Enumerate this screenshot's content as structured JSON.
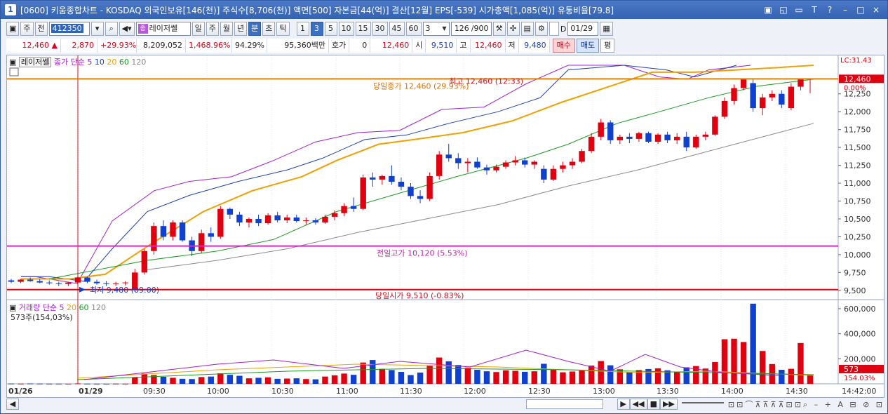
{
  "title": {
    "app_icon": "1",
    "text": "[0600] 키움종합차트 - KOSDAQ 외국인보유[146(천)] 주식수[8,706(천)] 액면[500] 자본금[44(억)] 결산[12월] EPS[-539] 시가총액[1,085(억)] 유통비율[79.8]"
  },
  "window_buttons": [
    "▣",
    "◱",
    "▭",
    "T",
    "?",
    "–",
    "□",
    "×"
  ],
  "toolbar": {
    "jm": "주",
    "jeon": "전",
    "code": "412350",
    "name": "레이저쎌",
    "periods": [
      "일",
      "주",
      "월",
      "년",
      "분",
      "초",
      "틱"
    ],
    "active_period": "분",
    "intervals": [
      "1",
      "3",
      "5",
      "10",
      "15",
      "30",
      "45",
      "60"
    ],
    "active_interval": "3",
    "interval_value": "3",
    "count": "126",
    "count_total": "/900",
    "date": "01/29",
    "date_prefix": "D"
  },
  "quote": {
    "price": "12,460",
    "change": "2,870",
    "change_pct": "+29.93%",
    "volume": "8,209,052",
    "volume_pct": "1,468.96%",
    "ratio": "94.29%",
    "amount": "95,360백만",
    "hoga_label": "호가",
    "hoga_value": "0",
    "hoga_price": "12,460",
    "open_label": "시",
    "open": "9,510",
    "high_label": "고",
    "high": "12,460",
    "low_label": "저",
    "low": "9,480",
    "buy_label": "매수",
    "sell_label": "매도",
    "avg_label": "평"
  },
  "price_legend": {
    "name": "레이저쎌",
    "ma_label": "종가 단순",
    "ma_periods": [
      "5",
      "10",
      "20",
      "60",
      "120"
    ],
    "ma_colors": [
      "#a020d0",
      "#1f3fb5",
      "#f0a000",
      "#1a9a20",
      "#888888"
    ]
  },
  "volume_legend": {
    "label": "거래량 단순",
    "periods": [
      "5",
      "20",
      "60",
      "120"
    ],
    "info": "573주(154,03%)"
  },
  "annotations": {
    "today_close": "당일종가 12,460 (29.93%)",
    "high": "최고 12,460 (12:33)",
    "prev_high": "전일고가 10,120 (5.53%)",
    "low": "최저 9,480 (09:00)",
    "today_open": "당일시가 9,510 (-0.83%)",
    "lc": "LC:31.43",
    "price_box": "12,460",
    "pct_box": "0.00%",
    "vol_box": "573",
    "vol_pct_box": "154.03%"
  },
  "chart_data": {
    "type": "candlestick",
    "price_axis": {
      "min": 9400,
      "max": 12650,
      "ticks": [
        "12,250",
        "12,000",
        "11,750",
        "11,500",
        "11,250",
        "11,000",
        "10,750",
        "10,500",
        "10,250",
        "10,000",
        "9,750",
        "9,500"
      ]
    },
    "volume_axis": {
      "min": 0,
      "max": 650000,
      "ticks": [
        "600,000",
        "400,000",
        "200,000"
      ]
    },
    "time_labels": [
      "01/26",
      "01/29",
      "09:30",
      "10:00",
      "10:30",
      "11:00",
      "11:30",
      "12:00",
      "12:30",
      "13:00",
      "13:30",
      "14:00",
      "14:30",
      "14:42:00"
    ],
    "levels": {
      "today_close": 12460,
      "prev_high": 10120,
      "today_open": 9510
    },
    "candles": [
      [
        9640,
        9660,
        9600,
        9620
      ],
      [
        9620,
        9660,
        9600,
        9650
      ],
      [
        9650,
        9680,
        9620,
        9630
      ],
      [
        9630,
        9660,
        9600,
        9610
      ],
      [
        9610,
        9640,
        9580,
        9600
      ],
      [
        9600,
        9620,
        9560,
        9590
      ],
      [
        9590,
        9620,
        9560,
        9610
      ],
      [
        9610,
        9700,
        9590,
        9680
      ],
      [
        9680,
        9690,
        9600,
        9620
      ],
      [
        9620,
        9650,
        9580,
        9600
      ],
      [
        9600,
        9630,
        9560,
        9590
      ],
      [
        9590,
        9620,
        9560,
        9600
      ],
      [
        9600,
        9630,
        9570,
        9610
      ],
      [
        9510,
        9800,
        9480,
        9750
      ],
      [
        9750,
        10080,
        9720,
        10050
      ],
      [
        10050,
        10450,
        10000,
        10400
      ],
      [
        10400,
        10480,
        10200,
        10250
      ],
      [
        10250,
        10480,
        10200,
        10450
      ],
      [
        10450,
        10480,
        10180,
        10200
      ],
      [
        10200,
        10250,
        9980,
        10050
      ],
      [
        10050,
        10350,
        10020,
        10300
      ],
      [
        10300,
        10380,
        10180,
        10250
      ],
      [
        10250,
        10680,
        10220,
        10640
      ],
      [
        10640,
        10660,
        10500,
        10560
      ],
      [
        10560,
        10600,
        10400,
        10450
      ],
      [
        10450,
        10520,
        10380,
        10500
      ],
      [
        10500,
        10560,
        10400,
        10440
      ],
      [
        10440,
        10580,
        10420,
        10550
      ],
      [
        10550,
        10600,
        10450,
        10480
      ],
      [
        10480,
        10560,
        10440,
        10520
      ],
      [
        10520,
        10560,
        10450,
        10470
      ],
      [
        10470,
        10520,
        10420,
        10480
      ],
      [
        10480,
        10510,
        10420,
        10450
      ],
      [
        10450,
        10560,
        10430,
        10530
      ],
      [
        10530,
        10620,
        10480,
        10580
      ],
      [
        10580,
        10720,
        10540,
        10680
      ],
      [
        10680,
        10800,
        10600,
        10640
      ],
      [
        10640,
        11120,
        10620,
        11080
      ],
      [
        11080,
        11150,
        10950,
        11050
      ],
      [
        11050,
        11120,
        10980,
        11100
      ],
      [
        11100,
        11250,
        10980,
        11020
      ],
      [
        11020,
        11080,
        10900,
        10950
      ],
      [
        10950,
        11000,
        10780,
        10820
      ],
      [
        10820,
        10900,
        10720,
        10780
      ],
      [
        10780,
        11150,
        10750,
        11100
      ],
      [
        11100,
        11450,
        11050,
        11400
      ],
      [
        11400,
        11550,
        11300,
        11350
      ],
      [
        11350,
        11420,
        11200,
        11280
      ],
      [
        11280,
        11350,
        11150,
        11300
      ],
      [
        11300,
        11360,
        11200,
        11220
      ],
      [
        11220,
        11260,
        11120,
        11180
      ],
      [
        11180,
        11260,
        11150,
        11230
      ],
      [
        11230,
        11320,
        11200,
        11290
      ],
      [
        11290,
        11380,
        11250,
        11320
      ],
      [
        11320,
        11360,
        11220,
        11260
      ],
      [
        11260,
        11320,
        11200,
        11300
      ],
      [
        11200,
        11250,
        11000,
        11050
      ],
      [
        11050,
        11250,
        11030,
        11200
      ],
      [
        11200,
        11300,
        11150,
        11250
      ],
      [
        11250,
        11350,
        11200,
        11300
      ],
      [
        11300,
        11480,
        11280,
        11450
      ],
      [
        11450,
        11700,
        11420,
        11650
      ],
      [
        11650,
        11900,
        11600,
        11850
      ],
      [
        11850,
        11880,
        11550,
        11600
      ],
      [
        11600,
        11680,
        11550,
        11650
      ],
      [
        11650,
        11700,
        11560,
        11620
      ],
      [
        11620,
        11720,
        11580,
        11700
      ],
      [
        11700,
        11720,
        11560,
        11580
      ],
      [
        11580,
        11700,
        11550,
        11680
      ],
      [
        11680,
        11720,
        11560,
        11600
      ],
      [
        11600,
        11700,
        11550,
        11650
      ],
      [
        11650,
        11720,
        11450,
        11500
      ],
      [
        11500,
        11680,
        11480,
        11650
      ],
      [
        11650,
        11720,
        11600,
        11680
      ],
      [
        11680,
        11950,
        11660,
        11930
      ],
      [
        11930,
        12200,
        11900,
        12150
      ],
      [
        12150,
        12380,
        12100,
        12330
      ],
      [
        12330,
        12460,
        12300,
        12460
      ],
      [
        12400,
        12460,
        12000,
        12050
      ],
      [
        12050,
        12250,
        11950,
        12200
      ],
      [
        12200,
        12300,
        12150,
        12250
      ],
      [
        12250,
        12300,
        12050,
        12100
      ],
      [
        12050,
        12400,
        12020,
        12350
      ],
      [
        12350,
        12460,
        12300,
        12460
      ],
      [
        12460,
        12460,
        12260,
        12460
      ]
    ],
    "volumes": [
      2000,
      1500,
      2500,
      1800,
      1200,
      1500,
      1000,
      3000,
      1500,
      1200,
      1000,
      1500,
      1200,
      52000,
      82000,
      70000,
      56000,
      48000,
      40000,
      38000,
      54000,
      58000,
      84000,
      72000,
      64000,
      44000,
      48000,
      52000,
      40000,
      42000,
      44000,
      38000,
      36000,
      58000,
      68000,
      82000,
      72000,
      170000,
      190000,
      120000,
      110000,
      95000,
      70000,
      90000,
      148000,
      210000,
      180000,
      150000,
      128000,
      112000,
      100000,
      94000,
      108000,
      104000,
      96000,
      100000,
      160000,
      116000,
      92000,
      98000,
      110000,
      146000,
      182000,
      148000,
      116000,
      94000,
      110000,
      118000,
      124000,
      108000,
      98000,
      132000,
      142000,
      122000,
      174000,
      356000,
      360000,
      334000,
      640000,
      262000,
      158000,
      112000,
      120000,
      326000,
      73000
    ],
    "ma_lines": {
      "ma5": [
        [
          20,
          0.91
        ],
        [
          40,
          0.91
        ],
        [
          100,
          0.94
        ],
        [
          150,
          0.67
        ],
        [
          210,
          0.54
        ],
        [
          260,
          0.5
        ],
        [
          320,
          0.48
        ],
        [
          380,
          0.41
        ],
        [
          440,
          0.33
        ],
        [
          500,
          0.29
        ],
        [
          560,
          0.28
        ],
        [
          620,
          0.19
        ],
        [
          680,
          0.18
        ],
        [
          740,
          0.08
        ],
        [
          800,
          0.0
        ],
        [
          880,
          0.0
        ],
        [
          930,
          0.05
        ],
        [
          970,
          0.06
        ],
        [
          1000,
          0.02
        ],
        [
          1060,
          0.0
        ]
      ],
      "ma10": [
        [
          20,
          0.91
        ],
        [
          60,
          0.91
        ],
        [
          110,
          0.93
        ],
        [
          150,
          0.79
        ],
        [
          200,
          0.63
        ],
        [
          260,
          0.56
        ],
        [
          330,
          0.5
        ],
        [
          400,
          0.45
        ],
        [
          450,
          0.4
        ],
        [
          510,
          0.32
        ],
        [
          570,
          0.3
        ],
        [
          630,
          0.25
        ],
        [
          700,
          0.2
        ],
        [
          760,
          0.14
        ],
        [
          800,
          0.02
        ],
        [
          880,
          0.0
        ],
        [
          940,
          0.02
        ],
        [
          980,
          0.05
        ],
        [
          1040,
          0.0
        ]
      ],
      "ma20": [
        [
          20,
          0.92
        ],
        [
          90,
          0.92
        ],
        [
          140,
          0.9
        ],
        [
          210,
          0.76
        ],
        [
          280,
          0.63
        ],
        [
          350,
          0.54
        ],
        [
          420,
          0.48
        ],
        [
          470,
          0.41
        ],
        [
          530,
          0.34
        ],
        [
          580,
          0.32
        ],
        [
          650,
          0.29
        ],
        [
          720,
          0.24
        ],
        [
          790,
          0.16
        ],
        [
          860,
          0.09
        ],
        [
          920,
          0.03
        ],
        [
          980,
          0.03
        ],
        [
          1100,
          0.01
        ],
        [
          1150,
          0.0
        ]
      ],
      "ma60": [
        [
          60,
          0.92
        ],
        [
          200,
          0.84
        ],
        [
          300,
          0.8
        ],
        [
          380,
          0.75
        ],
        [
          470,
          0.63
        ],
        [
          560,
          0.55
        ],
        [
          640,
          0.48
        ],
        [
          740,
          0.4
        ],
        [
          800,
          0.34
        ],
        [
          870,
          0.25
        ],
        [
          930,
          0.2
        ],
        [
          1000,
          0.14
        ],
        [
          1070,
          0.09
        ],
        [
          1150,
          0.06
        ]
      ],
      "ma120": [
        [
          200,
          0.88
        ],
        [
          300,
          0.84
        ],
        [
          400,
          0.79
        ],
        [
          500,
          0.72
        ],
        [
          600,
          0.66
        ],
        [
          700,
          0.6
        ],
        [
          800,
          0.52
        ],
        [
          900,
          0.45
        ],
        [
          1000,
          0.37
        ],
        [
          1100,
          0.29
        ],
        [
          1150,
          0.25
        ]
      ]
    }
  }
}
